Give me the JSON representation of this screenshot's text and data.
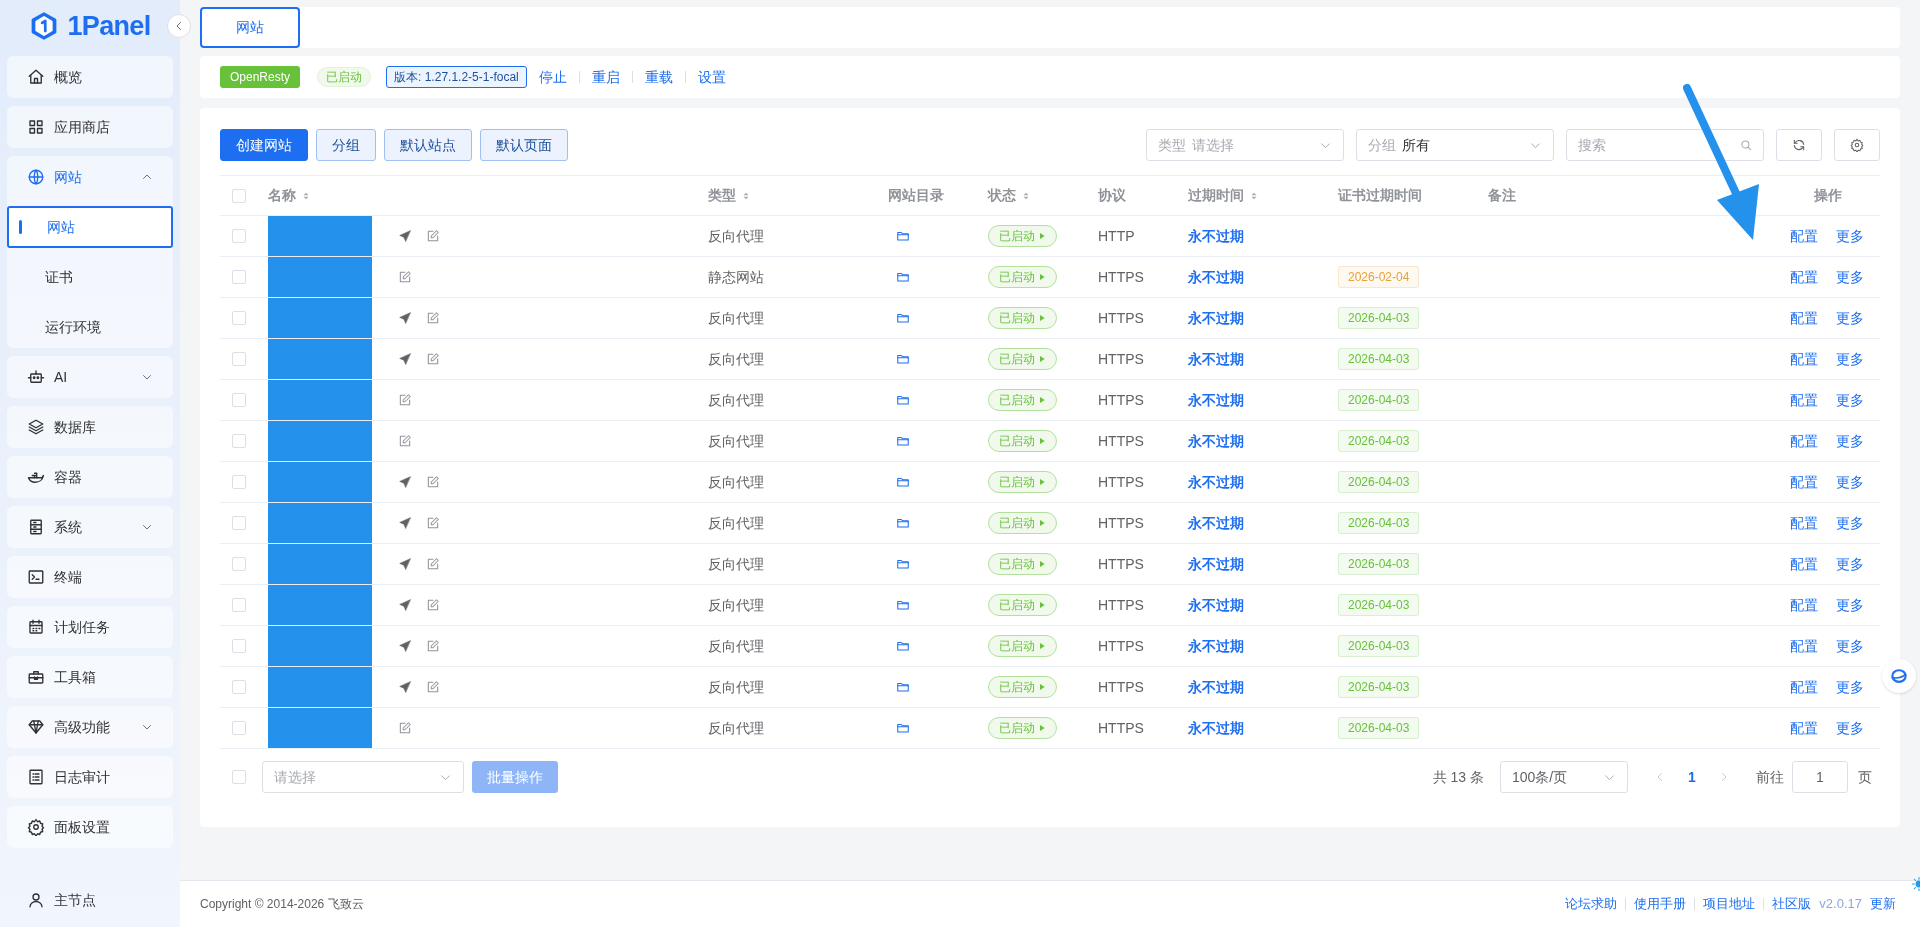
{
  "sidebar": {
    "logo": "1Panel",
    "items": [
      {
        "label": "概览"
      },
      {
        "label": "应用商店"
      },
      {
        "label": "网站",
        "expanded": true,
        "children": [
          {
            "label": "网站",
            "selected": true
          },
          {
            "label": "证书",
            "selected": false
          },
          {
            "label": "运行环境",
            "selected": false
          }
        ]
      },
      {
        "label": "AI",
        "expanded": false
      },
      {
        "label": "数据库"
      },
      {
        "label": "容器"
      },
      {
        "label": "系统",
        "expanded": false
      },
      {
        "label": "终端"
      },
      {
        "label": "计划任务"
      },
      {
        "label": "工具箱"
      },
      {
        "label": "高级功能",
        "expanded": false
      },
      {
        "label": "日志审计"
      },
      {
        "label": "面板设置"
      }
    ],
    "node": "主节点"
  },
  "tabs": [
    {
      "label": "网站",
      "selected": true
    }
  ],
  "server": {
    "name": "OpenResty",
    "status": "已启动",
    "version": "版本: 1.27.1.2-5-1-focal",
    "actions": [
      "停止",
      "重启",
      "重载",
      "设置"
    ]
  },
  "toolbar": {
    "buttons": [
      {
        "label": "创建网站",
        "kind": "primary"
      },
      {
        "label": "分组",
        "kind": "plain"
      },
      {
        "label": "默认站点",
        "kind": "plain"
      },
      {
        "label": "默认页面",
        "kind": "plain"
      }
    ],
    "type_filter": {
      "label": "类型",
      "placeholder": "请选择"
    },
    "group_filter": {
      "label": "分组",
      "value": "所有"
    },
    "search": {
      "placeholder": "搜索"
    }
  },
  "table": {
    "all_checked": false,
    "columns": [
      {
        "label": "名称",
        "sortable": true
      },
      {
        "label": "类型",
        "sortable": true
      },
      {
        "label": "网站目录",
        "sortable": false
      },
      {
        "label": "状态",
        "sortable": true
      },
      {
        "label": "协议",
        "sortable": false
      },
      {
        "label": "过期时间",
        "sortable": true
      },
      {
        "label": "证书过期时间",
        "sortable": false
      },
      {
        "label": "备注",
        "sortable": false
      },
      {
        "label": "操作",
        "sortable": false
      }
    ],
    "rows": [
      {
        "checked": false,
        "proxy": true,
        "type": "反向代理",
        "status": "已启动",
        "protocol": "HTTP",
        "expires": "永不过期",
        "actions": [
          "配置",
          "更多"
        ]
      },
      {
        "checked": false,
        "proxy": false,
        "type": "静态网站",
        "status": "已启动",
        "protocol": "HTTPS",
        "expires": "永不过期",
        "cert": {
          "date": "2026-02-04",
          "color": "#e6a23c"
        },
        "actions": [
          "配置",
          "更多"
        ]
      },
      {
        "checked": false,
        "proxy": true,
        "type": "反向代理",
        "status": "已启动",
        "protocol": "HTTPS",
        "expires": "永不过期",
        "cert": {
          "date": "2026-04-03",
          "color": "#67c23a"
        },
        "actions": [
          "配置",
          "更多"
        ]
      },
      {
        "checked": false,
        "proxy": true,
        "type": "反向代理",
        "status": "已启动",
        "protocol": "HTTPS",
        "expires": "永不过期",
        "cert": {
          "date": "2026-04-03",
          "color": "#67c23a"
        },
        "actions": [
          "配置",
          "更多"
        ]
      },
      {
        "checked": false,
        "proxy": false,
        "type": "反向代理",
        "status": "已启动",
        "protocol": "HTTPS",
        "expires": "永不过期",
        "cert": {
          "date": "2026-04-03",
          "color": "#67c23a"
        },
        "actions": [
          "配置",
          "更多"
        ]
      },
      {
        "checked": false,
        "proxy": false,
        "type": "反向代理",
        "status": "已启动",
        "protocol": "HTTPS",
        "expires": "永不过期",
        "cert": {
          "date": "2026-04-03",
          "color": "#67c23a"
        },
        "actions": [
          "配置",
          "更多"
        ]
      },
      {
        "checked": false,
        "proxy": true,
        "type": "反向代理",
        "status": "已启动",
        "protocol": "HTTPS",
        "expires": "永不过期",
        "cert": {
          "date": "2026-04-03",
          "color": "#67c23a"
        },
        "actions": [
          "配置",
          "更多"
        ]
      },
      {
        "checked": false,
        "proxy": true,
        "type": "反向代理",
        "status": "已启动",
        "protocol": "HTTPS",
        "expires": "永不过期",
        "cert": {
          "date": "2026-04-03",
          "color": "#67c23a"
        },
        "actions": [
          "配置",
          "更多"
        ]
      },
      {
        "checked": false,
        "proxy": true,
        "type": "反向代理",
        "status": "已启动",
        "protocol": "HTTPS",
        "expires": "永不过期",
        "cert": {
          "date": "2026-04-03",
          "color": "#67c23a"
        },
        "actions": [
          "配置",
          "更多"
        ]
      },
      {
        "checked": false,
        "proxy": true,
        "type": "反向代理",
        "status": "已启动",
        "protocol": "HTTPS",
        "expires": "永不过期",
        "cert": {
          "date": "2026-04-03",
          "color": "#67c23a"
        },
        "actions": [
          "配置",
          "更多"
        ]
      },
      {
        "checked": false,
        "proxy": true,
        "type": "反向代理",
        "status": "已启动",
        "protocol": "HTTPS",
        "expires": "永不过期",
        "cert": {
          "date": "2026-04-03",
          "color": "#67c23a"
        },
        "actions": [
          "配置",
          "更多"
        ]
      },
      {
        "checked": false,
        "proxy": true,
        "type": "反向代理",
        "status": "已启动",
        "protocol": "HTTPS",
        "expires": "永不过期",
        "cert": {
          "date": "2026-04-03",
          "color": "#67c23a"
        },
        "actions": [
          "配置",
          "更多"
        ]
      },
      {
        "checked": false,
        "proxy": false,
        "type": "反向代理",
        "status": "已启动",
        "protocol": "HTTPS",
        "expires": "永不过期",
        "cert": {
          "date": "2026-04-03",
          "color": "#67c23a"
        },
        "actions": [
          "配置",
          "更多"
        ]
      }
    ]
  },
  "batch": {
    "checked": false,
    "placeholder": "请选择",
    "button": "批量操作",
    "disabled": true
  },
  "pagination": {
    "total": "共 13 条",
    "page_size": "100条/页",
    "pages": [
      {
        "label": "1",
        "selected": true
      }
    ],
    "goto_label": "前往",
    "goto_value": "1",
    "goto_suffix": "页"
  },
  "footer": {
    "copyright": "Copyright © 2014-2026 飞致云",
    "links": [
      "论坛求助",
      "使用手册",
      "项目地址",
      "社区版"
    ],
    "version": "v2.0.17",
    "update": "更新"
  }
}
